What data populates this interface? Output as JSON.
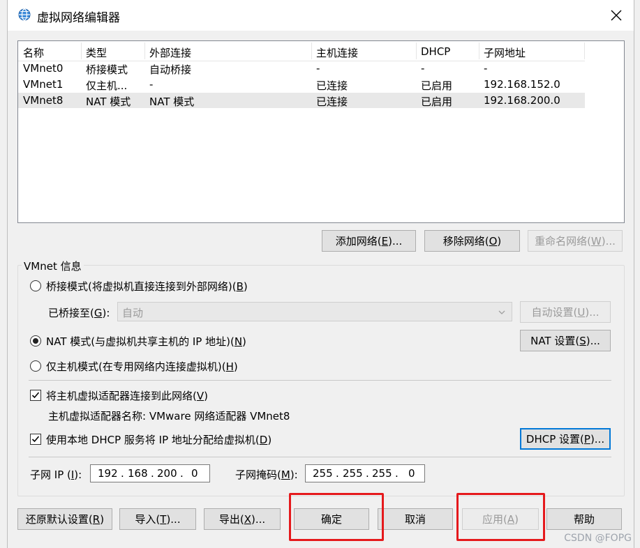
{
  "window": {
    "title": "虚拟网络编辑器",
    "icon": "globe-icon",
    "close_icon": "close-icon"
  },
  "network_list": {
    "columns": [
      "名称",
      "类型",
      "外部连接",
      "主机连接",
      "DHCP",
      "子网地址"
    ],
    "rows": [
      {
        "name": "VMnet0",
        "type": "桥接模式",
        "external": "自动桥接",
        "host": "-",
        "dhcp": "-",
        "subnet": "-"
      },
      {
        "name": "VMnet1",
        "type": "仅主机...",
        "external": "-",
        "host": "已连接",
        "dhcp": "已启用",
        "subnet": "192.168.152.0"
      },
      {
        "name": "VMnet8",
        "type": "NAT 模式",
        "external": "NAT 模式",
        "host": "已连接",
        "dhcp": "已启用",
        "subnet": "192.168.200.0"
      }
    ]
  },
  "list_buttons": {
    "add": {
      "text": "添加网络(",
      "key": "E",
      "tail": ")..."
    },
    "remove": {
      "text": "移除网络(",
      "key": "O",
      "tail": ")"
    },
    "rename": {
      "text": "重命名网络(",
      "key": "W",
      "tail": ")..."
    }
  },
  "vmnet_info": {
    "group_label": "VMnet 信息",
    "bridged": {
      "text": "桥接模式(将虚拟机直接连接到外部网络)(",
      "key": "B",
      "tail": ")"
    },
    "bridged_to": {
      "text": "已桥接至(",
      "key": "G",
      "tail": "):"
    },
    "bridged_value": "自动",
    "auto_settings": {
      "text": "自动设置(",
      "key": "U",
      "tail": ")..."
    },
    "nat": {
      "text": "NAT 模式(与虚拟机共享主机的 IP 地址)(",
      "key": "N",
      "tail": ")"
    },
    "nat_settings": {
      "text": "NAT 设置(",
      "key": "S",
      "tail": ")..."
    },
    "host_only": {
      "text": "仅主机模式(在专用网络内连接虚拟机)(",
      "key": "H",
      "tail": ")"
    },
    "connect_adapter": {
      "text": "将主机虚拟适配器连接到此网络(",
      "key": "V",
      "tail": ")"
    },
    "adapter_name": "主机虚拟适配器名称: VMware 网络适配器 VMnet8",
    "use_dhcp": {
      "text": "使用本地 DHCP 服务将 IP 地址分配给虚拟机(",
      "key": "D",
      "tail": ")"
    },
    "dhcp_settings": {
      "text": "DHCP 设置(",
      "key": "P",
      "tail": ")..."
    },
    "subnet_ip_label": {
      "text": "子网 IP (",
      "key": "I",
      "tail": "):"
    },
    "subnet_ip": [
      "192",
      "168",
      "200",
      "0"
    ],
    "subnet_mask_label": {
      "text": "子网掩码(",
      "key": "M",
      "tail": "):"
    },
    "subnet_mask": [
      "255",
      "255",
      "255",
      "0"
    ],
    "selected_mode": "nat",
    "connect_adapter_checked": true,
    "use_dhcp_checked": true
  },
  "footer": {
    "restore": {
      "text": "还原默认设置(",
      "key": "R",
      "tail": ")"
    },
    "import": {
      "text": "导入(",
      "key": "T",
      "tail": ")..."
    },
    "export": {
      "text": "导出(",
      "key": "X",
      "tail": ")..."
    },
    "ok": "确定",
    "cancel": "取消",
    "apply": {
      "text": "应用(",
      "key": "A",
      "tail": ")"
    },
    "help": "帮助"
  },
  "highlight_color": "#e5191c",
  "watermark": "CSDN @FOPG"
}
